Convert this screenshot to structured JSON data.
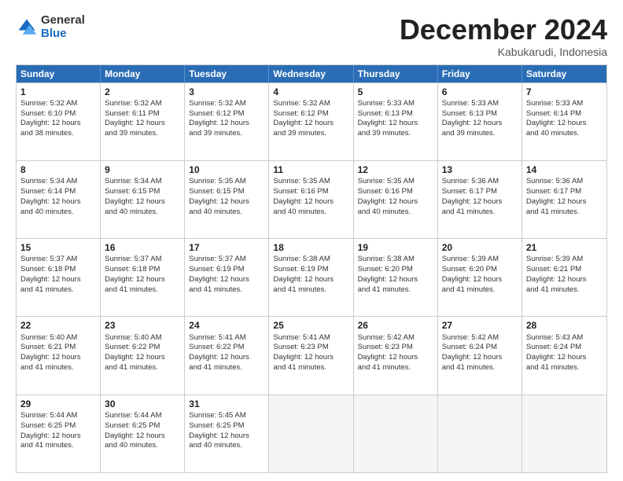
{
  "logo": {
    "general": "General",
    "blue": "Blue"
  },
  "title": "December 2024",
  "subtitle": "Kabukarudi, Indonesia",
  "header_days": [
    "Sunday",
    "Monday",
    "Tuesday",
    "Wednesday",
    "Thursday",
    "Friday",
    "Saturday"
  ],
  "rows": [
    [
      {
        "day": "1",
        "lines": [
          "Sunrise: 5:32 AM",
          "Sunset: 6:10 PM",
          "Daylight: 12 hours",
          "and 38 minutes."
        ]
      },
      {
        "day": "2",
        "lines": [
          "Sunrise: 5:32 AM",
          "Sunset: 6:11 PM",
          "Daylight: 12 hours",
          "and 39 minutes."
        ]
      },
      {
        "day": "3",
        "lines": [
          "Sunrise: 5:32 AM",
          "Sunset: 6:12 PM",
          "Daylight: 12 hours",
          "and 39 minutes."
        ]
      },
      {
        "day": "4",
        "lines": [
          "Sunrise: 5:32 AM",
          "Sunset: 6:12 PM",
          "Daylight: 12 hours",
          "and 39 minutes."
        ]
      },
      {
        "day": "5",
        "lines": [
          "Sunrise: 5:33 AM",
          "Sunset: 6:13 PM",
          "Daylight: 12 hours",
          "and 39 minutes."
        ]
      },
      {
        "day": "6",
        "lines": [
          "Sunrise: 5:33 AM",
          "Sunset: 6:13 PM",
          "Daylight: 12 hours",
          "and 39 minutes."
        ]
      },
      {
        "day": "7",
        "lines": [
          "Sunrise: 5:33 AM",
          "Sunset: 6:14 PM",
          "Daylight: 12 hours",
          "and 40 minutes."
        ]
      }
    ],
    [
      {
        "day": "8",
        "lines": [
          "Sunrise: 5:34 AM",
          "Sunset: 6:14 PM",
          "Daylight: 12 hours",
          "and 40 minutes."
        ]
      },
      {
        "day": "9",
        "lines": [
          "Sunrise: 5:34 AM",
          "Sunset: 6:15 PM",
          "Daylight: 12 hours",
          "and 40 minutes."
        ]
      },
      {
        "day": "10",
        "lines": [
          "Sunrise: 5:35 AM",
          "Sunset: 6:15 PM",
          "Daylight: 12 hours",
          "and 40 minutes."
        ]
      },
      {
        "day": "11",
        "lines": [
          "Sunrise: 5:35 AM",
          "Sunset: 6:16 PM",
          "Daylight: 12 hours",
          "and 40 minutes."
        ]
      },
      {
        "day": "12",
        "lines": [
          "Sunrise: 5:35 AM",
          "Sunset: 6:16 PM",
          "Daylight: 12 hours",
          "and 40 minutes."
        ]
      },
      {
        "day": "13",
        "lines": [
          "Sunrise: 5:36 AM",
          "Sunset: 6:17 PM",
          "Daylight: 12 hours",
          "and 41 minutes."
        ]
      },
      {
        "day": "14",
        "lines": [
          "Sunrise: 5:36 AM",
          "Sunset: 6:17 PM",
          "Daylight: 12 hours",
          "and 41 minutes."
        ]
      }
    ],
    [
      {
        "day": "15",
        "lines": [
          "Sunrise: 5:37 AM",
          "Sunset: 6:18 PM",
          "Daylight: 12 hours",
          "and 41 minutes."
        ]
      },
      {
        "day": "16",
        "lines": [
          "Sunrise: 5:37 AM",
          "Sunset: 6:18 PM",
          "Daylight: 12 hours",
          "and 41 minutes."
        ]
      },
      {
        "day": "17",
        "lines": [
          "Sunrise: 5:37 AM",
          "Sunset: 6:19 PM",
          "Daylight: 12 hours",
          "and 41 minutes."
        ]
      },
      {
        "day": "18",
        "lines": [
          "Sunrise: 5:38 AM",
          "Sunset: 6:19 PM",
          "Daylight: 12 hours",
          "and 41 minutes."
        ]
      },
      {
        "day": "19",
        "lines": [
          "Sunrise: 5:38 AM",
          "Sunset: 6:20 PM",
          "Daylight: 12 hours",
          "and 41 minutes."
        ]
      },
      {
        "day": "20",
        "lines": [
          "Sunrise: 5:39 AM",
          "Sunset: 6:20 PM",
          "Daylight: 12 hours",
          "and 41 minutes."
        ]
      },
      {
        "day": "21",
        "lines": [
          "Sunrise: 5:39 AM",
          "Sunset: 6:21 PM",
          "Daylight: 12 hours",
          "and 41 minutes."
        ]
      }
    ],
    [
      {
        "day": "22",
        "lines": [
          "Sunrise: 5:40 AM",
          "Sunset: 6:21 PM",
          "Daylight: 12 hours",
          "and 41 minutes."
        ]
      },
      {
        "day": "23",
        "lines": [
          "Sunrise: 5:40 AM",
          "Sunset: 6:22 PM",
          "Daylight: 12 hours",
          "and 41 minutes."
        ]
      },
      {
        "day": "24",
        "lines": [
          "Sunrise: 5:41 AM",
          "Sunset: 6:22 PM",
          "Daylight: 12 hours",
          "and 41 minutes."
        ]
      },
      {
        "day": "25",
        "lines": [
          "Sunrise: 5:41 AM",
          "Sunset: 6:23 PM",
          "Daylight: 12 hours",
          "and 41 minutes."
        ]
      },
      {
        "day": "26",
        "lines": [
          "Sunrise: 5:42 AM",
          "Sunset: 6:23 PM",
          "Daylight: 12 hours",
          "and 41 minutes."
        ]
      },
      {
        "day": "27",
        "lines": [
          "Sunrise: 5:42 AM",
          "Sunset: 6:24 PM",
          "Daylight: 12 hours",
          "and 41 minutes."
        ]
      },
      {
        "day": "28",
        "lines": [
          "Sunrise: 5:43 AM",
          "Sunset: 6:24 PM",
          "Daylight: 12 hours",
          "and 41 minutes."
        ]
      }
    ],
    [
      {
        "day": "29",
        "lines": [
          "Sunrise: 5:44 AM",
          "Sunset: 6:25 PM",
          "Daylight: 12 hours",
          "and 41 minutes."
        ]
      },
      {
        "day": "30",
        "lines": [
          "Sunrise: 5:44 AM",
          "Sunset: 6:25 PM",
          "Daylight: 12 hours",
          "and 40 minutes."
        ]
      },
      {
        "day": "31",
        "lines": [
          "Sunrise: 5:45 AM",
          "Sunset: 6:25 PM",
          "Daylight: 12 hours",
          "and 40 minutes."
        ]
      },
      {
        "day": "",
        "lines": []
      },
      {
        "day": "",
        "lines": []
      },
      {
        "day": "",
        "lines": []
      },
      {
        "day": "",
        "lines": []
      }
    ]
  ]
}
